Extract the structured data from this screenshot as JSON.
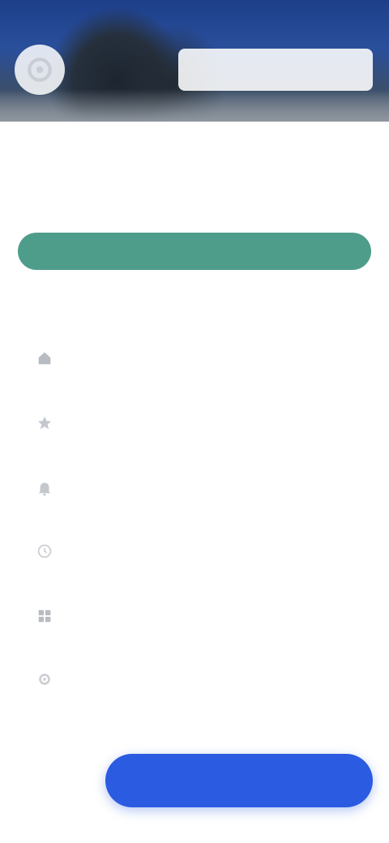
{
  "hero": {
    "title": "",
    "logo_icon": "app-logo-icon"
  },
  "main": {
    "heading": "",
    "description": "",
    "primary_action": ""
  },
  "list": {
    "section_title": "",
    "items": [
      {
        "label": "",
        "icon": "home-icon"
      },
      {
        "label": "",
        "icon": "star-icon"
      },
      {
        "label": "",
        "icon": "bell-icon"
      },
      {
        "label": "",
        "icon": "clock-icon"
      },
      {
        "label": "",
        "icon": "grid-icon"
      },
      {
        "label": "",
        "icon": "settings-icon"
      }
    ],
    "more_link": ""
  },
  "footer": {
    "secondary_label": "",
    "primary_label": ""
  },
  "colors": {
    "accent_teal": "#4e9d8a",
    "primary_blue": "#2a5be0",
    "link_blue": "#6f8fd6"
  }
}
